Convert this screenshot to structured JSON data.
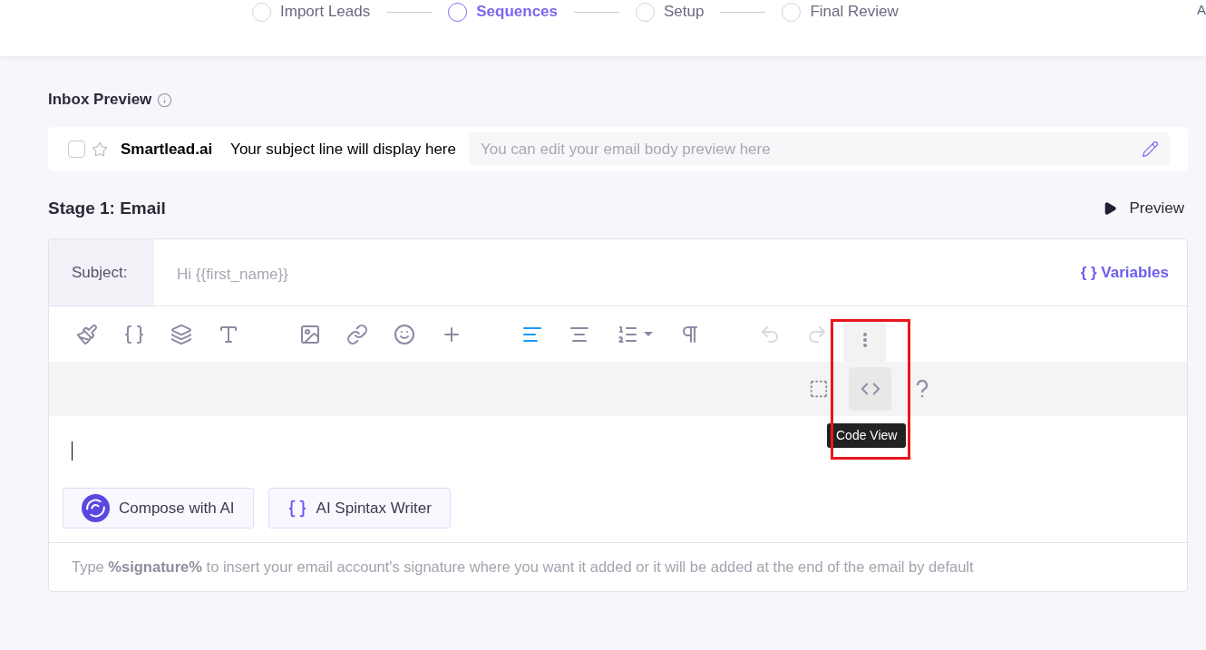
{
  "stepper": {
    "steps": [
      {
        "label": "Import Leads",
        "selected": false
      },
      {
        "label": "Sequences",
        "selected": true
      },
      {
        "label": "Setup",
        "selected": false
      },
      {
        "label": "Final Review",
        "selected": false
      }
    ],
    "edge_text": "A"
  },
  "inbox_preview": {
    "title": "Inbox Preview",
    "checked": false,
    "starred": false,
    "sender": "Smartlead.ai",
    "subject": "Your subject line will display here",
    "body_placeholder": "You can edit your email body preview here"
  },
  "stage": {
    "title": "Stage 1: Email",
    "preview_label": "Preview"
  },
  "editor": {
    "subject_label": "Subject:",
    "subject_placeholder": "Hi {{first_name}}",
    "variables_label": "{ } Variables",
    "toolbar": [
      {
        "kind": "brush",
        "active": false,
        "disabled": false
      },
      {
        "kind": "braces",
        "active": false,
        "disabled": false
      },
      {
        "kind": "layers",
        "active": false,
        "disabled": false
      },
      {
        "kind": "font-size",
        "active": false,
        "disabled": false
      },
      {
        "kind": "image",
        "active": false,
        "disabled": false
      },
      {
        "kind": "link",
        "active": false,
        "disabled": false
      },
      {
        "kind": "emoji",
        "active": false,
        "disabled": false
      },
      {
        "kind": "insert",
        "active": false,
        "disabled": false
      },
      {
        "kind": "align-left",
        "active": true,
        "disabled": false
      },
      {
        "kind": "align-center",
        "active": false,
        "disabled": false
      },
      {
        "kind": "ordered-list",
        "active": false,
        "disabled": false
      },
      {
        "kind": "paragraph",
        "active": false,
        "disabled": false
      },
      {
        "kind": "undo",
        "active": false,
        "disabled": true
      },
      {
        "kind": "redo",
        "active": false,
        "disabled": true
      },
      {
        "kind": "more",
        "active": false,
        "disabled": false
      }
    ],
    "toolbar_row2": [
      {
        "kind": "select-all",
        "hovered": false
      },
      {
        "kind": "code",
        "hovered": true
      },
      {
        "kind": "help",
        "hovered": false
      }
    ],
    "tooltip": "Code View",
    "ai_buttons": [
      {
        "kind": "compose",
        "label": "Compose with AI"
      },
      {
        "kind": "spintax",
        "label": "AI Spintax Writer"
      }
    ],
    "signature_hint": "Type **%signature%** to insert your email account's signature where you want it added or it will be added at the end of the email by default"
  }
}
